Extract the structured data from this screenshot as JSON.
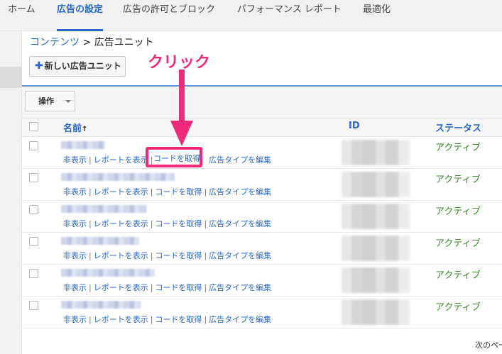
{
  "nav": {
    "tabs": [
      {
        "label": "ホーム"
      },
      {
        "label": "広告の設定"
      },
      {
        "label": "広告の許可とブロック"
      },
      {
        "label": "パフォーマンス レポート"
      },
      {
        "label": "最適化"
      }
    ]
  },
  "breadcrumb": {
    "parent": "コンテンツ",
    "separator": " > ",
    "current": "広告ユニット"
  },
  "toolbar": {
    "new_button": "新しい広告ユニット",
    "operations": "操作"
  },
  "table": {
    "headers": {
      "name": "名前",
      "sort_indicator": "↑",
      "id": "ID",
      "status": "ステータス"
    },
    "action_labels": {
      "hide": "非表示",
      "report": "レポートを表示",
      "get_code": "コードを取得",
      "edit_type": "広告タイプを編集"
    },
    "separator": "|",
    "rows": [
      {
        "status": "アクティブ"
      },
      {
        "status": "アクティブ"
      },
      {
        "status": "アクティブ"
      },
      {
        "status": "アクティブ"
      },
      {
        "status": "アクティブ"
      },
      {
        "status": "アクティブ"
      }
    ]
  },
  "annotation": {
    "text": "クリック",
    "color": "#ef2a7b"
  },
  "footer": {
    "next_page": "次のペー"
  },
  "colors": {
    "accent": "#2a67c8",
    "status_green": "#3a8a2a",
    "highlight": "#ef2a7b"
  }
}
